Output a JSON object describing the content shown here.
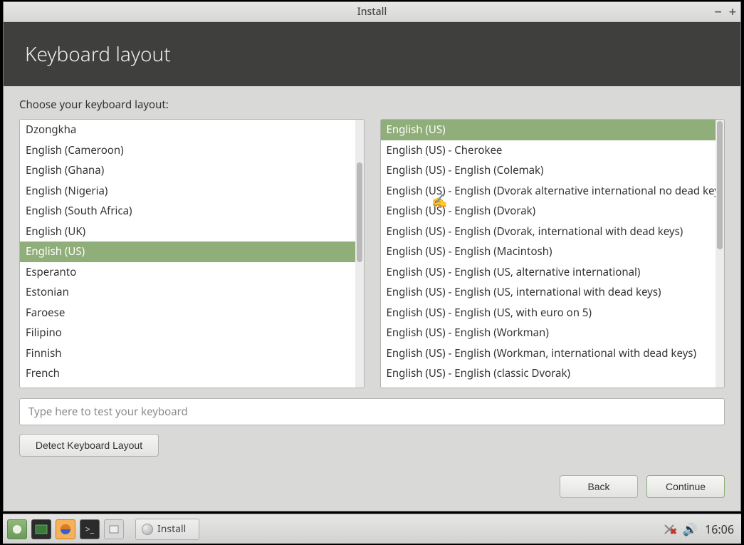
{
  "window": {
    "title": "Install"
  },
  "header": {
    "title": "Keyboard layout"
  },
  "instruction": "Choose your keyboard layout:",
  "left_list": {
    "selected_index": 6,
    "items": [
      "Dzongkha",
      "English (Cameroon)",
      "English (Ghana)",
      "English (Nigeria)",
      "English (South Africa)",
      "English (UK)",
      "English (US)",
      "Esperanto",
      "Estonian",
      "Faroese",
      "Filipino",
      "Finnish",
      "French"
    ]
  },
  "right_list": {
    "selected_index": 0,
    "items": [
      "English (US)",
      "English (US) - Cherokee",
      "English (US) - English (Colemak)",
      "English (US) - English (Dvorak alternative international no dead keys)",
      "English (US) - English (Dvorak)",
      "English (US) - English (Dvorak, international with dead keys)",
      "English (US) - English (Macintosh)",
      "English (US) - English (US, alternative international)",
      "English (US) - English (US, international with dead keys)",
      "English (US) - English (US, with euro on 5)",
      "English (US) - English (Workman)",
      "English (US) - English (Workman, international with dead keys)",
      "English (US) - English (classic Dvorak)"
    ]
  },
  "test_input": {
    "placeholder": "Type here to test your keyboard"
  },
  "buttons": {
    "detect": "Detect Keyboard Layout",
    "back": "Back",
    "continue": "Continue"
  },
  "taskbar": {
    "task": "Install",
    "clock": "16:06"
  }
}
